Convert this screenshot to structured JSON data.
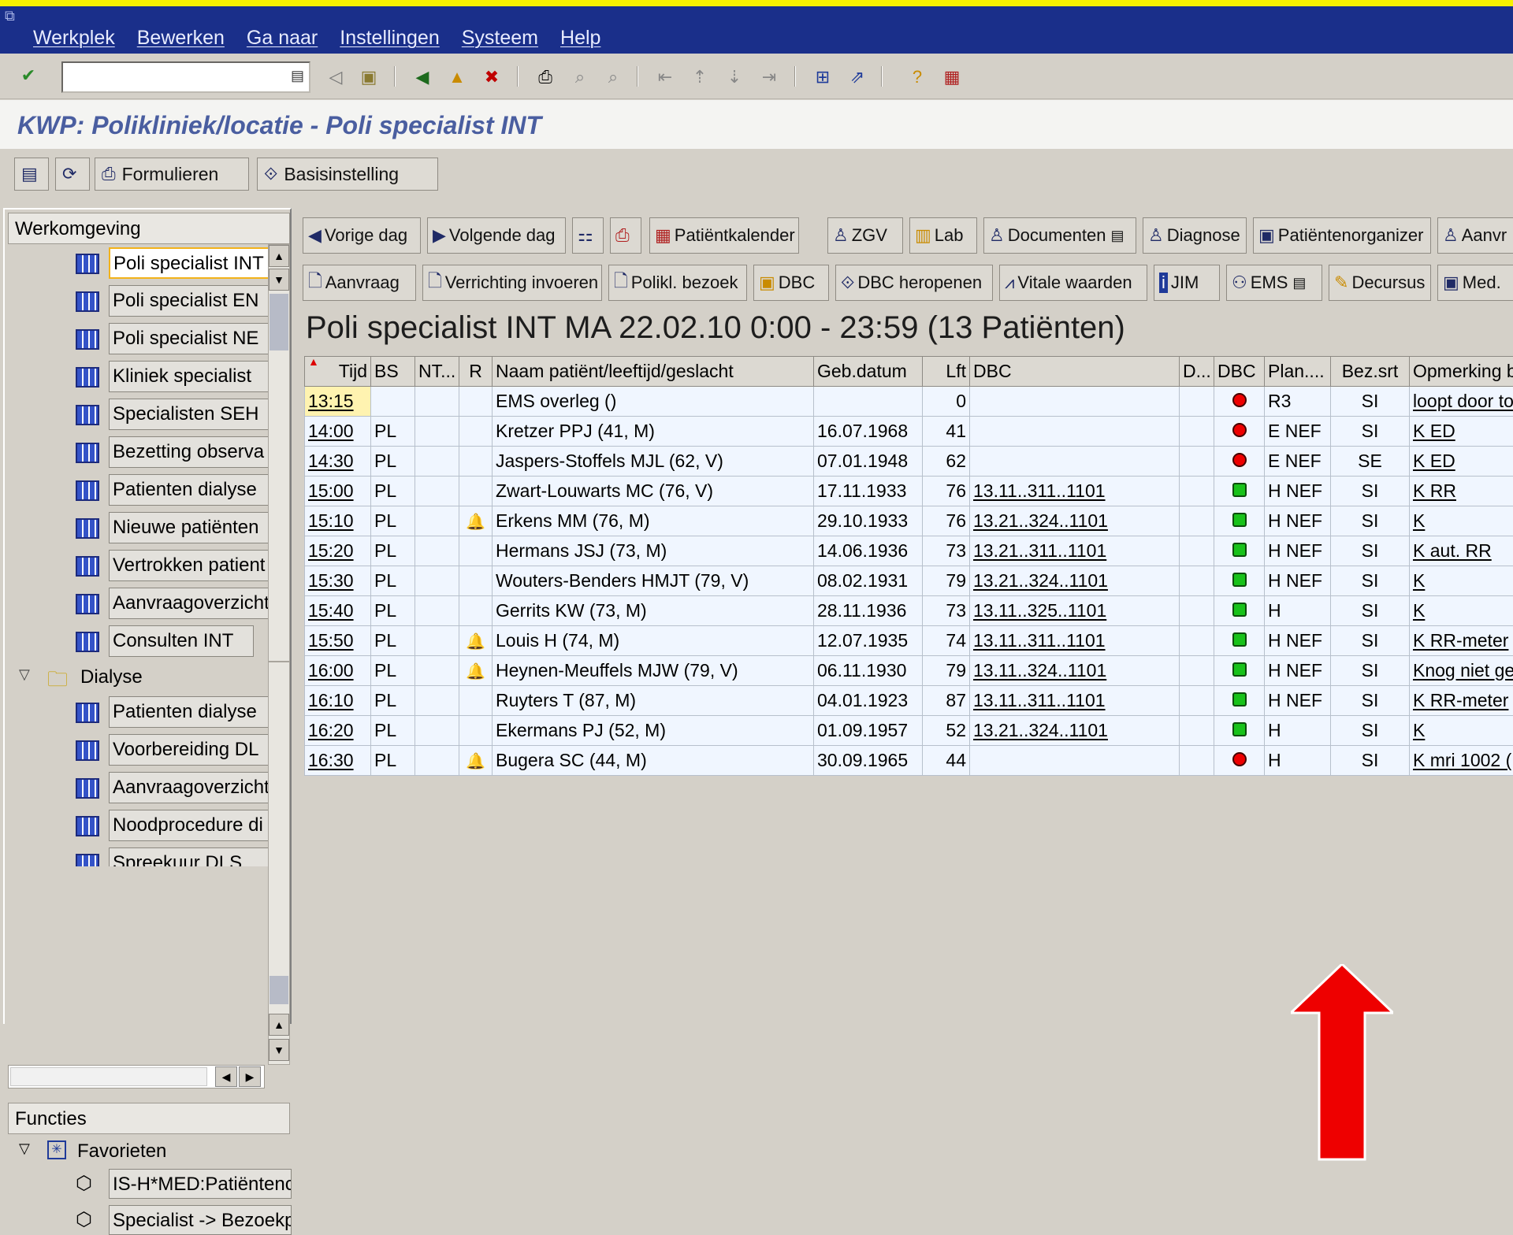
{
  "menu": [
    "Werkplek",
    "Bewerken",
    "Ga naar",
    "Instellingen",
    "Systeem",
    "Help"
  ],
  "title": "KWP: Polikliniek/locatie - Poli specialist INT",
  "app_toolbar": {
    "formulieren": "Formulieren",
    "basisinstelling": "Basisinstelling"
  },
  "left": {
    "werkomgeving": "Werkomgeving",
    "items": [
      "Poli specialist INT",
      "Poli specialist EN",
      "Poli specialist NE",
      "Kliniek specialist",
      "Specialisten SEH",
      "Bezetting observa",
      "Patienten dialyse",
      "Nieuwe patiënten",
      "Vertrokken patient",
      "Aanvraagoverzicht",
      "Consulten INT"
    ],
    "folder": "Dialyse",
    "sub_items": [
      "Patienten dialyse",
      "Voorbereiding DL",
      "Aanvraagoverzicht",
      "Noodprocedure di",
      "Spreekuur DLS"
    ],
    "functies": "Functies",
    "favorieten": "Favorieten",
    "fav_items": [
      "IS-H*MED:Patiëntenc",
      "Specialist -> Bezoekp"
    ]
  },
  "buttons_row1": [
    "Vorige dag",
    "Volgende dag",
    "",
    "",
    "Patiëntkalender",
    "ZGV",
    "Lab",
    "Documenten",
    "Diagnose",
    "Patiëntenorganizer",
    "Aanvr"
  ],
  "buttons_row2": [
    "Aanvraag",
    "Verrichting invoeren",
    "Polikl. bezoek",
    "DBC",
    "DBC heropenen",
    "Vitale waarden",
    "JIM",
    "EMS",
    "Decursus",
    "Med."
  ],
  "day_title": "Poli specialist INT MA 22.02.10  0:00 - 23:59 (13 Patiënten)",
  "table": {
    "headers": [
      "Tijd",
      "BS",
      "NT...",
      "R",
      "Naam patiënt/leeftijd/geslacht",
      "Geb.datum",
      "Lft",
      "DBC",
      "D...",
      "DBC",
      "Plan....",
      "Bez.srt",
      "Opmerking b"
    ],
    "rows": [
      {
        "tijd": "13:15",
        "bs": "",
        "nt": "",
        "r": false,
        "naam": "EMS overleg ()",
        "geb": "",
        "lft": "0",
        "dbc": "",
        "d": "",
        "status": "red",
        "plan": "R3",
        "bez": "SI",
        "opm": "loopt door to"
      },
      {
        "tijd": "14:00",
        "bs": "PL",
        "nt": "",
        "r": false,
        "naam": "Kretzer PPJ (41, M)",
        "geb": "16.07.1968",
        "lft": "41",
        "dbc": "",
        "d": "",
        "status": "red",
        "plan": "E NEF",
        "bez": "SI",
        "opm": "K ED"
      },
      {
        "tijd": "14:30",
        "bs": "PL",
        "nt": "",
        "r": false,
        "naam": "Jaspers-Stoffels MJL (62, V)",
        "geb": "07.01.1948",
        "lft": "62",
        "dbc": "",
        "d": "",
        "status": "red",
        "plan": "E NEF",
        "bez": "SE",
        "opm": "K ED"
      },
      {
        "tijd": "15:00",
        "bs": "PL",
        "nt": "",
        "r": false,
        "naam": "Zwart-Louwarts MC (76, V)",
        "geb": "17.11.1933",
        "lft": "76",
        "dbc": "13.11..311..1101",
        "d": "",
        "status": "green",
        "plan": "H NEF",
        "bez": "SI",
        "opm": "K  RR"
      },
      {
        "tijd": "15:10",
        "bs": "PL",
        "nt": "",
        "r": true,
        "naam": "Erkens MM (76, M)",
        "geb": "29.10.1933",
        "lft": "76",
        "dbc": "13.21..324..1101",
        "d": "",
        "status": "green",
        "plan": "H NEF",
        "bez": "SI",
        "opm": "K"
      },
      {
        "tijd": "15:20",
        "bs": "PL",
        "nt": "",
        "r": false,
        "naam": "Hermans JSJ (73, M)",
        "geb": "14.06.1936",
        "lft": "73",
        "dbc": "13.21..311..1101",
        "d": "",
        "status": "green",
        "plan": "H NEF",
        "bez": "SI",
        "opm": "K aut. RR"
      },
      {
        "tijd": "15:30",
        "bs": "PL",
        "nt": "",
        "r": false,
        "naam": "Wouters-Benders HMJT (79, V)",
        "geb": "08.02.1931",
        "lft": "79",
        "dbc": "13.21..324..1101",
        "d": "",
        "status": "green",
        "plan": "H NEF",
        "bez": "SI",
        "opm": "K"
      },
      {
        "tijd": "15:40",
        "bs": "PL",
        "nt": "",
        "r": false,
        "naam": "Gerrits KW (73, M)",
        "geb": "28.11.1936",
        "lft": "73",
        "dbc": "13.11..325..1101",
        "d": "",
        "status": "green",
        "plan": "H",
        "bez": "SI",
        "opm": "K"
      },
      {
        "tijd": "15:50",
        "bs": "PL",
        "nt": "",
        "r": true,
        "naam": "Louis H (74, M)",
        "geb": "12.07.1935",
        "lft": "74",
        "dbc": "13.11..311..1101",
        "d": "",
        "status": "green",
        "plan": "H NEF",
        "bez": "SI",
        "opm": "K RR-meter"
      },
      {
        "tijd": "16:00",
        "bs": "PL",
        "nt": "",
        "r": true,
        "naam": "Heynen-Meuffels MJW (79, V)",
        "geb": "06.11.1930",
        "lft": "79",
        "dbc": "13.11..324..1101",
        "d": "",
        "status": "green",
        "plan": "H NEF",
        "bez": "SI",
        "opm": "Knog niet ge"
      },
      {
        "tijd": "16:10",
        "bs": "PL",
        "nt": "",
        "r": false,
        "naam": "Ruyters T (87, M)",
        "geb": "04.01.1923",
        "lft": "87",
        "dbc": "13.11..311..1101",
        "d": "",
        "status": "green",
        "plan": "H NEF",
        "bez": "SI",
        "opm": "K RR-meter"
      },
      {
        "tijd": "16:20",
        "bs": "PL",
        "nt": "",
        "r": false,
        "naam": "Ekermans PJ (52, M)",
        "geb": "01.09.1957",
        "lft": "52",
        "dbc": "13.21..324..1101",
        "d": "",
        "status": "green",
        "plan": "H",
        "bez": "SI",
        "opm": "K"
      },
      {
        "tijd": "16:30",
        "bs": "PL",
        "nt": "",
        "r": true,
        "naam": "Bugera SC (44, M)",
        "geb": "30.09.1965",
        "lft": "44",
        "dbc": "",
        "d": "",
        "status": "red",
        "plan": "H",
        "bez": "SI",
        "opm": "K mri 1002 ("
      }
    ]
  },
  "colors": {
    "menubar": "#1a2f8a",
    "title_text": "#4a5ea0",
    "annotation_arrow": "#ee0000",
    "selected_border": "#f2b21a"
  }
}
